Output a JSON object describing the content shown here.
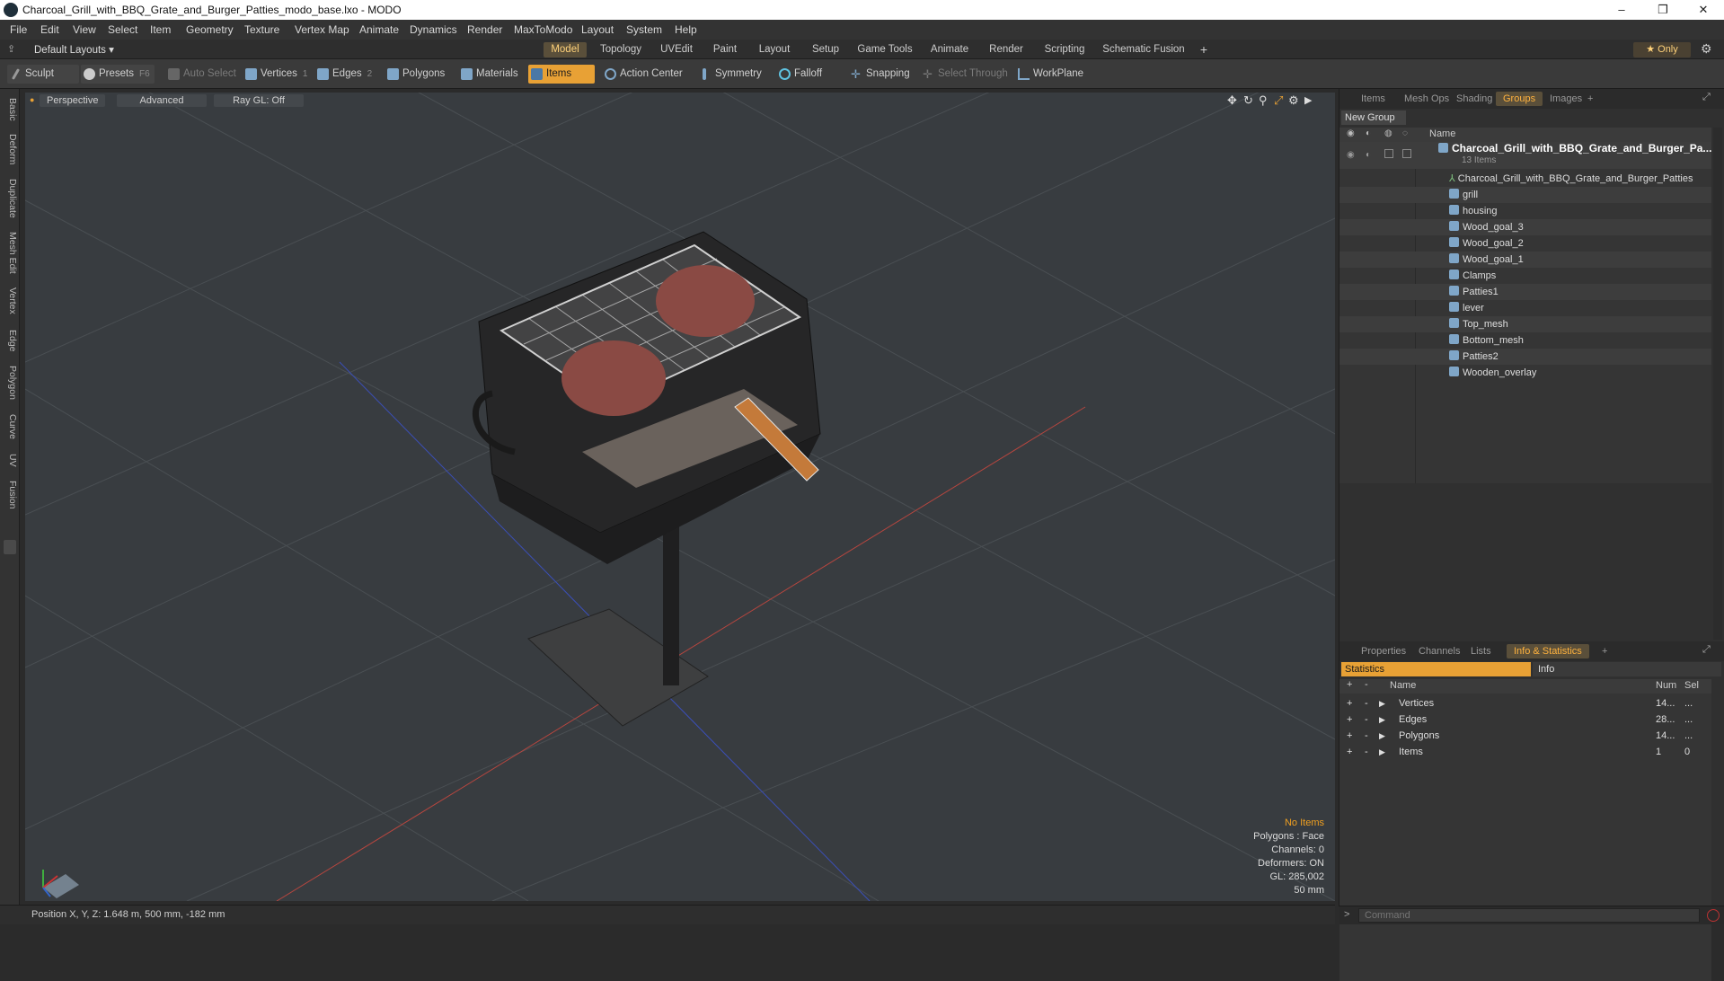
{
  "window": {
    "title": "Charcoal_Grill_with_BBQ_Grate_and_Burger_Patties_modo_base.lxo - MODO",
    "minimize": "–",
    "maximize": "❐",
    "close": "✕"
  },
  "menu": [
    "File",
    "Edit",
    "View",
    "Select",
    "Item",
    "Geometry",
    "Texture",
    "Vertex Map",
    "Animate",
    "Dynamics",
    "Render",
    "MaxToModo",
    "Layout",
    "System",
    "Help"
  ],
  "layout_selector": "Default Layouts ▾",
  "layout_tabs": [
    "Model",
    "Topology",
    "UVEdit",
    "Paint",
    "Layout",
    "Setup",
    "Game Tools",
    "Animate",
    "Render",
    "Scripting",
    "Schematic Fusion"
  ],
  "add_tab": "+",
  "only_label": "★ Only",
  "toolbar": {
    "sculpt": "Sculpt",
    "presets": "Presets",
    "presets_key": "F6",
    "auto_select": "Auto Select",
    "vertices": "Vertices",
    "vertices_key": "1",
    "edges": "Edges",
    "edges_key": "2",
    "polygons": "Polygons",
    "materials": "Materials",
    "items": "Items",
    "action_center": "Action Center",
    "symmetry": "Symmetry",
    "falloff": "Falloff",
    "snapping": "Snapping",
    "select_through": "Select Through",
    "workplane": "WorkPlane"
  },
  "left_tabs": [
    "Basic",
    "Deform",
    "Duplicate",
    "Mesh Edit",
    "Vertex",
    "Edge",
    "Polygon",
    "Curve",
    "UV",
    "Fusion"
  ],
  "viewport": {
    "perspective": "Perspective",
    "advanced": "Advanced",
    "raygl": "Ray GL: Off",
    "stats": {
      "no_items": "No Items",
      "polygons": "Polygons : Face",
      "channels": "Channels: 0",
      "deformers": "Deformers: ON",
      "gl": "GL: 285,002",
      "scale": "50 mm"
    }
  },
  "statusbar": {
    "position": "Position X, Y, Z:   1.648 m, 500 mm, -182 mm"
  },
  "groups_panel": {
    "tabs": [
      "Items",
      "Mesh Ops",
      "Shading",
      "Groups",
      "Images"
    ],
    "active_tab": "Groups",
    "new_group": "New Group",
    "name_header": "Name",
    "group_name": "Charcoal_Grill_with_BBQ_Grate_and_Burger_Pa...",
    "group_count": "13 Items",
    "items": [
      "Charcoal_Grill_with_BBQ_Grate_and_Burger_Patties",
      "grill",
      "housing",
      "Wood_goal_3",
      "Wood_goal_2",
      "Wood_goal_1",
      "Clamps",
      "Patties1",
      "lever",
      "Top_mesh",
      "Bottom_mesh",
      "Patties2",
      "Wooden_overlay"
    ]
  },
  "info_panel": {
    "tabs": [
      "Properties",
      "Channels",
      "Lists",
      "Info & Statistics"
    ],
    "active_tab": "Info & Statistics",
    "statistics_label": "Statistics",
    "info_label": "Info",
    "headers": {
      "name": "Name",
      "num": "Num",
      "sel": "Sel"
    },
    "rows": [
      {
        "name": "Vertices",
        "num": "14...",
        "sel": "..."
      },
      {
        "name": "Edges",
        "num": "28...",
        "sel": "..."
      },
      {
        "name": "Polygons",
        "num": "14...",
        "sel": "..."
      },
      {
        "name": "Items",
        "num": "1",
        "sel": "0"
      }
    ]
  },
  "command": {
    "placeholder": "Command"
  }
}
